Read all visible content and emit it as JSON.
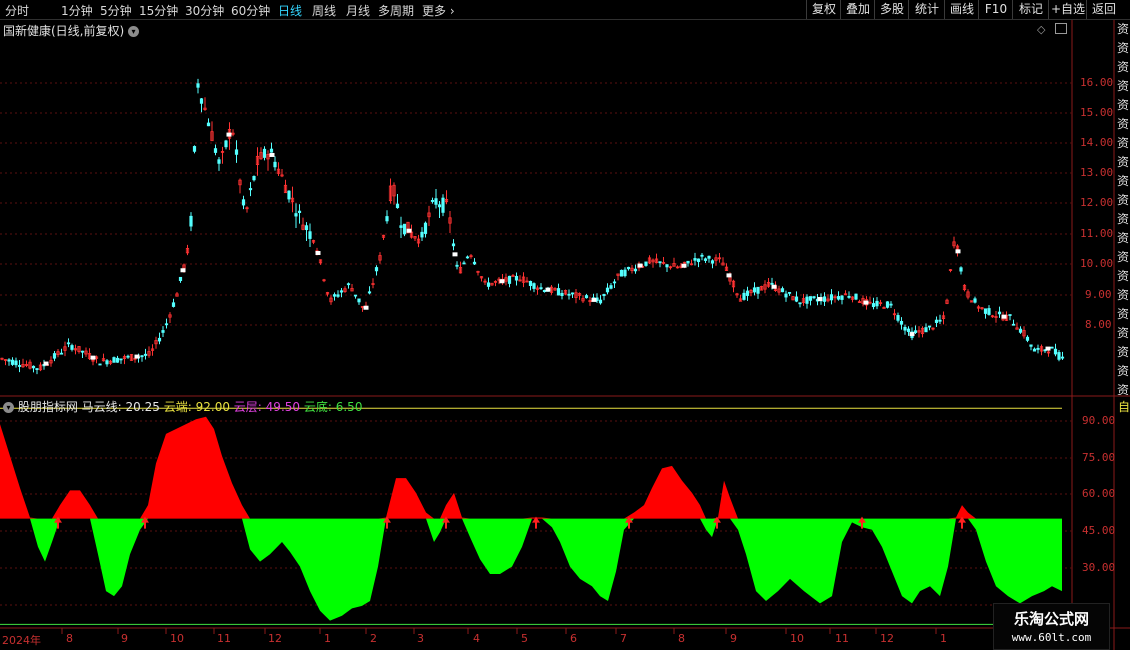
{
  "toolbar": {
    "periods": [
      "分时",
      "1分钟",
      "5分钟",
      "15分钟",
      "30分钟",
      "60分钟",
      "日线",
      "周线",
      "月线",
      "多周期",
      "更多"
    ],
    "active_period": "日线",
    "right_buttons": [
      "复权",
      "叠加",
      "多股",
      "统计",
      "画线",
      "F10",
      "标记",
      "+自选",
      "返回"
    ]
  },
  "main_panel": {
    "title": "国新健康(日线,前复权)",
    "y_ticks": [
      "16.00",
      "15.00",
      "14.00",
      "13.00",
      "12.00",
      "11.00",
      "10.00",
      "9.00",
      "8.00"
    ],
    "side_chars": [
      "资",
      "资",
      "资",
      "资",
      "资",
      "资",
      "资",
      "资",
      "资",
      "资",
      "资",
      "资",
      "资",
      "资",
      "资",
      "资",
      "资",
      "资",
      "资",
      "资",
      "资"
    ]
  },
  "indicator_panel": {
    "name": "股朋指标网",
    "items": [
      {
        "label": "马云线:",
        "value": "20.25",
        "color": "#e6e6e6"
      },
      {
        "label": "云端:",
        "value": "92.00",
        "color": "#e8e040"
      },
      {
        "label": "云层:",
        "value": "49.50",
        "color": "#e040e0"
      },
      {
        "label": "云底:",
        "value": "6.50",
        "color": "#40e040"
      }
    ],
    "y_ticks": [
      "90.00",
      "75.00",
      "60.00",
      "45.00",
      "30.00"
    ],
    "side_label": "自"
  },
  "date_axis": [
    "2024年",
    "8",
    "9",
    "10",
    "11",
    "12",
    "1",
    "2",
    "3",
    "4",
    "5",
    "6",
    "7",
    "8",
    "9",
    "10",
    "11",
    "12",
    "1"
  ],
  "watermark": {
    "title": "乐淘公式网",
    "url": "www.60lt.com"
  },
  "colors": {
    "up": "#ff3232",
    "down": "#54ffff",
    "cloud_top": "#ff0000",
    "cloud_bottom": "#00ff00"
  },
  "chart_data": {
    "type": "area",
    "series": [
      {
        "name": "马云线",
        "last": 20.25
      },
      {
        "name": "云端",
        "value": 92.0
      },
      {
        "name": "云层",
        "value": 49.5
      },
      {
        "name": "云底",
        "value": 6.5
      }
    ],
    "price_ylim": [
      7.5,
      17.5
    ],
    "indicator_ylim": [
      5,
      97
    ],
    "indicator_points": [
      [
        0,
        88
      ],
      [
        10,
        75
      ],
      [
        20,
        62
      ],
      [
        30,
        50
      ],
      [
        38,
        38
      ],
      [
        45,
        32
      ],
      [
        52,
        40
      ],
      [
        60,
        55
      ],
      [
        70,
        61
      ],
      [
        80,
        61
      ],
      [
        90,
        55
      ],
      [
        98,
        35
      ],
      [
        106,
        20
      ],
      [
        114,
        18
      ],
      [
        122,
        22
      ],
      [
        130,
        35
      ],
      [
        140,
        45
      ],
      [
        148,
        55
      ],
      [
        156,
        72
      ],
      [
        166,
        84
      ],
      [
        176,
        86
      ],
      [
        186,
        88
      ],
      [
        196,
        90
      ],
      [
        206,
        91
      ],
      [
        214,
        86
      ],
      [
        222,
        75
      ],
      [
        232,
        64
      ],
      [
        242,
        55
      ],
      [
        250,
        37
      ],
      [
        260,
        32
      ],
      [
        270,
        35
      ],
      [
        282,
        40
      ],
      [
        290,
        36
      ],
      [
        300,
        30
      ],
      [
        310,
        20
      ],
      [
        320,
        12
      ],
      [
        330,
        8
      ],
      [
        342,
        10
      ],
      [
        352,
        13
      ],
      [
        362,
        14
      ],
      [
        370,
        16
      ],
      [
        378,
        30
      ],
      [
        386,
        50
      ],
      [
        396,
        66
      ],
      [
        406,
        66
      ],
      [
        416,
        60
      ],
      [
        426,
        52
      ],
      [
        434,
        40
      ],
      [
        440,
        44
      ],
      [
        446,
        55
      ],
      [
        454,
        60
      ],
      [
        462,
        50
      ],
      [
        470,
        42
      ],
      [
        480,
        33
      ],
      [
        490,
        27
      ],
      [
        500,
        27
      ],
      [
        512,
        30
      ],
      [
        522,
        38
      ],
      [
        532,
        50
      ],
      [
        542,
        50
      ],
      [
        552,
        46
      ],
      [
        560,
        40
      ],
      [
        570,
        30
      ],
      [
        580,
        25
      ],
      [
        592,
        22
      ],
      [
        600,
        18
      ],
      [
        608,
        16
      ],
      [
        616,
        28
      ],
      [
        624,
        45
      ],
      [
        634,
        52
      ],
      [
        644,
        55
      ],
      [
        652,
        62
      ],
      [
        662,
        70
      ],
      [
        672,
        71
      ],
      [
        682,
        65
      ],
      [
        692,
        60
      ],
      [
        700,
        55
      ],
      [
        706,
        45
      ],
      [
        712,
        42
      ],
      [
        718,
        50
      ],
      [
        724,
        65
      ],
      [
        730,
        58
      ],
      [
        738,
        45
      ],
      [
        746,
        35
      ],
      [
        756,
        20
      ],
      [
        766,
        16
      ],
      [
        778,
        20
      ],
      [
        790,
        25
      ],
      [
        804,
        20
      ],
      [
        820,
        15
      ],
      [
        832,
        18
      ],
      [
        842,
        40
      ],
      [
        852,
        48
      ],
      [
        862,
        46
      ],
      [
        872,
        45
      ],
      [
        882,
        38
      ],
      [
        892,
        28
      ],
      [
        902,
        18
      ],
      [
        912,
        15
      ],
      [
        920,
        20
      ],
      [
        930,
        22
      ],
      [
        940,
        18
      ],
      [
        948,
        30
      ],
      [
        956,
        50
      ],
      [
        962,
        55
      ],
      [
        968,
        52
      ],
      [
        976,
        45
      ],
      [
        986,
        32
      ],
      [
        996,
        22
      ],
      [
        1008,
        18
      ],
      [
        1020,
        15
      ],
      [
        1032,
        18
      ],
      [
        1044,
        20
      ],
      [
        1052,
        22
      ],
      [
        1062,
        20
      ]
    ],
    "arrows_x": [
      58,
      145,
      387,
      446,
      536,
      629,
      717,
      862,
      962
    ]
  }
}
